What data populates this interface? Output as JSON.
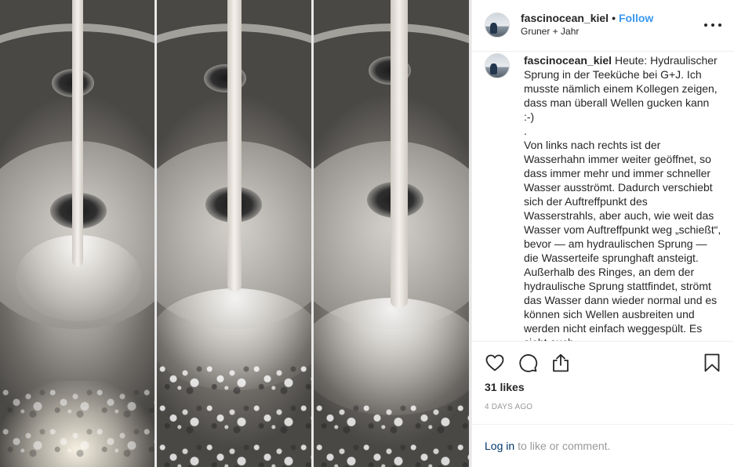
{
  "header": {
    "username": "fascinocean_kiel",
    "separator": "•",
    "follow_label": "Follow",
    "location": "Gruner + Jahr"
  },
  "caption": {
    "username": "fascinocean_kiel",
    "text": "Heute: Hydraulischer Sprung in der Teeküche bei G+J. Ich musste nämlich einem Kollegen zeigen, dass man überall Wellen gucken kann :-)\n.\nVon links nach rechts ist der Wasserhahn immer weiter geöffnet, so dass immer mehr und immer schneller Wasser ausströmt. Dadurch verschiebt sich der Auftreffpunkt des Wasserstrahls, aber auch, wie weit das Wasser vom Auftreffpunkt weg „schießt“, bevor — am hydraulischen Sprung — die Wasserteife sprunghaft ansteigt. Außerhalb des Ringes, an dem der hydraulische Sprung stattfindet, strömt das Wasser dann wieder normal und es können sich Wellen ausbreiten und werden nicht einfach weggespült. Es sieht auch"
  },
  "actions": {
    "icons": [
      "heart-icon",
      "comment-icon",
      "share-icon",
      "bookmark-icon"
    ],
    "likes": "31 likes",
    "timestamp": "4 DAYS AGO"
  },
  "login": {
    "link_label": "Log in",
    "rest": "to like or comment."
  },
  "colors": {
    "follow": "#3897f0",
    "login_link": "#003569",
    "muted": "#999999",
    "text": "#262626"
  }
}
